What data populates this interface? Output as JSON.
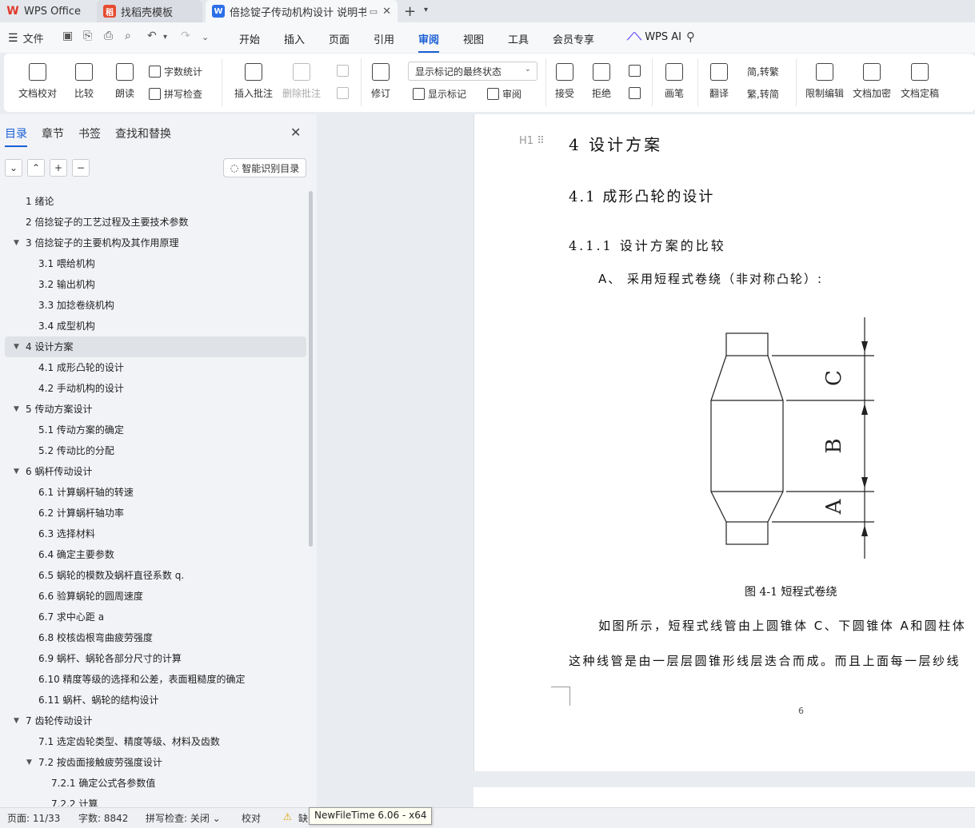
{
  "tabs": {
    "wps": "WPS Office",
    "template": "找稻壳模板",
    "doc": "倍捻锭子传动机构设计 说明书"
  },
  "menu": {
    "file": "文件",
    "items": [
      "开始",
      "插入",
      "页面",
      "引用",
      "审阅",
      "视图",
      "工具",
      "会员专享"
    ],
    "active": "审阅",
    "ai": "WPS AI"
  },
  "ribbon": {
    "doc_check": "文档校对",
    "compare": "比较",
    "read_aloud": "朗读",
    "word_count": "字数统计",
    "spell_check": "拼写检查",
    "insert_comment": "插入批注",
    "delete_comment": "删除批注",
    "revise": "修订",
    "display_state": "显示标记的最终状态",
    "show_marks": "显示标记",
    "review": "审阅",
    "accept": "接受",
    "reject": "拒绝",
    "pen": "画笔",
    "translate": "翻译",
    "to_traditional": "简,转繁",
    "to_simplified": "繁,转简",
    "restrict_edit": "限制编辑",
    "encrypt": "文档加密",
    "finalize": "文档定稿"
  },
  "nav": {
    "tabs": [
      "目录",
      "章节",
      "书签",
      "查找和替换"
    ],
    "active": "目录",
    "smart_toc": "智能识别目录"
  },
  "toc": [
    {
      "label": "1  绪论",
      "level": 1,
      "arrow": ""
    },
    {
      "label": "2  倍捻锭子的工艺过程及主要技术参数",
      "level": 1,
      "arrow": ""
    },
    {
      "label": "3  倍捻锭子的主要机构及其作用原理",
      "level": 1,
      "arrow": "▼"
    },
    {
      "label": "3.1  喂给机构",
      "level": 2,
      "arrow": ""
    },
    {
      "label": "3.2  输出机构",
      "level": 2,
      "arrow": ""
    },
    {
      "label": "3.3  加捻卷绕机构",
      "level": 2,
      "arrow": ""
    },
    {
      "label": "3.4  成型机构",
      "level": 2,
      "arrow": ""
    },
    {
      "label": "4  设计方案",
      "level": 1,
      "arrow": "▼",
      "selected": true
    },
    {
      "label": "4.1  成形凸轮的设计",
      "level": 2,
      "arrow": ""
    },
    {
      "label": "4.2  手动机构的设计",
      "level": 2,
      "arrow": ""
    },
    {
      "label": "5  传动方案设计",
      "level": 1,
      "arrow": "▼"
    },
    {
      "label": "5.1  传动方案的确定",
      "level": 2,
      "arrow": ""
    },
    {
      "label": "5.2  传动比的分配",
      "level": 2,
      "arrow": ""
    },
    {
      "label": "6  蜗杆传动设计",
      "level": 1,
      "arrow": "▼"
    },
    {
      "label": "6.1  计算蜗杆轴的转速",
      "level": 2,
      "arrow": ""
    },
    {
      "label": "6.2  计算蜗杆轴功率",
      "level": 2,
      "arrow": ""
    },
    {
      "label": "6.3  选择材料",
      "level": 2,
      "arrow": ""
    },
    {
      "label": "6.4  确定主要参数",
      "level": 2,
      "arrow": ""
    },
    {
      "label": "6.5  蜗轮的模数及蜗杆直径系数 q.",
      "level": 2,
      "arrow": ""
    },
    {
      "label": "6.6  验算蜗轮的圆周速度",
      "level": 2,
      "arrow": ""
    },
    {
      "label": "6.7  求中心距 a",
      "level": 2,
      "arrow": ""
    },
    {
      "label": "6.8  校核齿根弯曲疲劳强度",
      "level": 2,
      "arrow": ""
    },
    {
      "label": "6.9  蜗杆、蜗轮各部分尺寸的计算",
      "level": 2,
      "arrow": ""
    },
    {
      "label": "6.10  精度等级的选择和公差，表面粗糙度的确定",
      "level": 2,
      "arrow": ""
    },
    {
      "label": "6.11  蜗杆、蜗轮的结构设计",
      "level": 2,
      "arrow": ""
    },
    {
      "label": "7  齿轮传动设计",
      "level": 1,
      "arrow": "▼"
    },
    {
      "label": "7.1  选定齿轮类型、精度等级、材料及齿数",
      "level": 2,
      "arrow": ""
    },
    {
      "label": "7.2  按齿面接触疲劳强度设计",
      "level": 2,
      "arrow": "▼"
    },
    {
      "label": "7.2.1  确定公式各参数值",
      "level": 3,
      "arrow": ""
    },
    {
      "label": "7.2.2  计算",
      "level": 3,
      "arrow": ""
    }
  ],
  "doc": {
    "h1": "4 设计方案",
    "h2": "4.1 成形凸轮的设计",
    "h3": "4.1.1 设计方案的比较",
    "para_a": "A、   采用短程式卷绕（非对称凸轮）:",
    "fig_labels": {
      "c": "C",
      "b": "B",
      "a": "A"
    },
    "caption": "图 4-1 短程式卷绕",
    "body1": "如图所示，短程式线管由上圆锥体 C、下圆锥体 A和圆柱体",
    "body2": "这种线管是由一层层圆锥形线层迭合而成。而且上面每一层纱线",
    "page_number": "6",
    "heading_mark": "H1"
  },
  "status": {
    "page": "页面: 11/33",
    "words": "字数: 8842",
    "spell": "拼写检查: 关闭",
    "proof": "校对",
    "missing": "缺",
    "tooltip": "NewFileTime 6.06 - x64"
  }
}
